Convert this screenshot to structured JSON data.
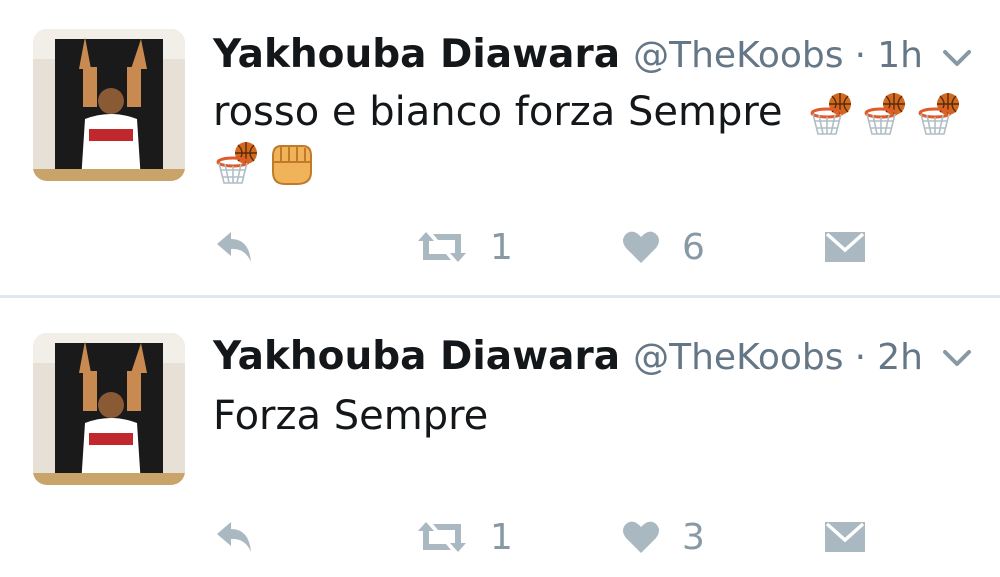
{
  "tweets": [
    {
      "name": "Yakhouba Diawara",
      "handle": "@TheKoobs",
      "separator": "·",
      "time": "1h",
      "text": "rosso e bianco forza Sempre",
      "emojis_line1": [
        "basketball-hoop",
        "basketball-hoop",
        "basketball-hoop"
      ],
      "emojis_line2": [
        "basketball-hoop",
        "fist"
      ],
      "retweets": "1",
      "likes": "6"
    },
    {
      "name": "Yakhouba Diawara",
      "handle": "@TheKoobs",
      "separator": "·",
      "time": "2h",
      "text": "Forza Sempre",
      "retweets": "1",
      "likes": "3"
    }
  ],
  "colors": {
    "icon": "#aab8c2",
    "text": "#14171a",
    "muted": "#657786",
    "divider": "#e1e8ed"
  }
}
